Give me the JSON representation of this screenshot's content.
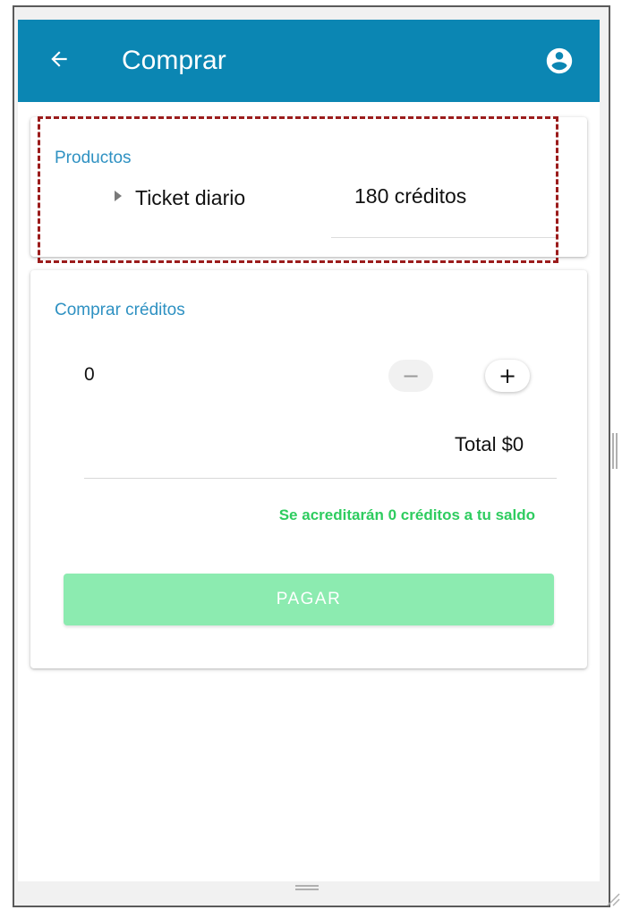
{
  "appbar": {
    "title": "Comprar",
    "back_icon": "arrow-left-icon",
    "account_icon": "account-circle-icon",
    "color": "#0b86b3"
  },
  "products": {
    "title": "Productos",
    "items": [
      {
        "name": "Ticket diario",
        "price": "180 créditos",
        "icon": "caret-right-icon"
      }
    ]
  },
  "buy_credits": {
    "title": "Comprar créditos",
    "quantity": "0",
    "decrement_icon": "minus-icon",
    "increment_icon": "plus-icon",
    "total": "Total $0",
    "note": "Se acreditarán 0 créditos a tu saldo",
    "note_color": "#2ecc5f",
    "pay_label": "PAGAR",
    "pay_color": "#8cebb0"
  },
  "highlight_color": "#9b1c1c"
}
